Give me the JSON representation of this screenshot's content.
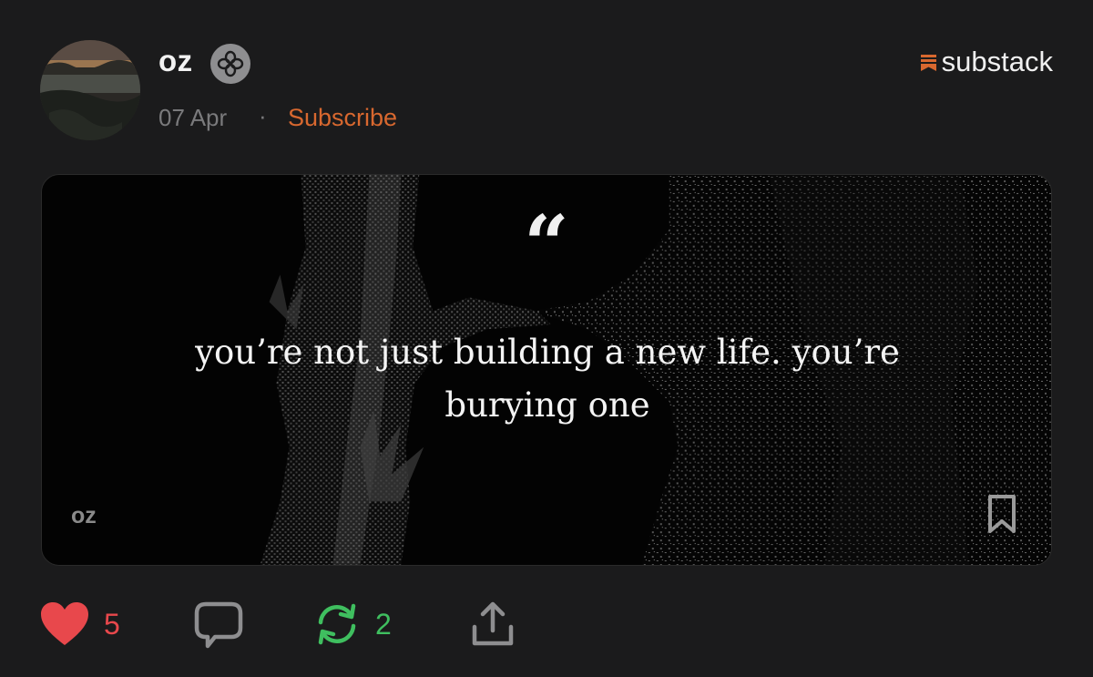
{
  "post": {
    "author": "oz",
    "date": "07 Apr",
    "separator": "·",
    "subscribe_label": "Subscribe",
    "brand": "substack"
  },
  "card": {
    "quote_mark": "“",
    "quote": "you’re not just building a new life. you’re burying one",
    "author": "oz"
  },
  "actions": {
    "likes": "5",
    "restacks": "2"
  },
  "colors": {
    "accent": "#d8682f",
    "like": "#e8484c",
    "restack": "#3fbf5f",
    "background": "#1b1b1c"
  },
  "icons": {
    "badge": "flower-badge-icon",
    "brand": "substack-logo-icon",
    "bookmark": "bookmark-icon",
    "like": "heart-icon",
    "comment": "comment-icon",
    "restack": "restack-icon",
    "share": "share-icon"
  }
}
